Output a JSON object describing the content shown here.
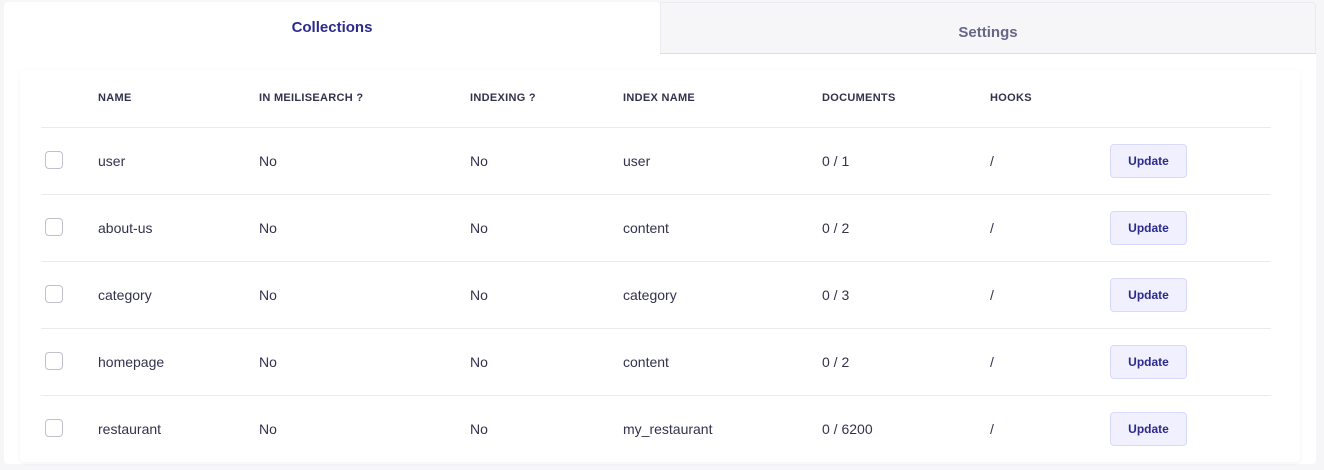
{
  "tabs": [
    {
      "label": "Collections",
      "active": true
    },
    {
      "label": "Settings",
      "active": false
    }
  ],
  "table": {
    "headers": {
      "name": "NAME",
      "in_meilisearch": "IN MEILISEARCH ?",
      "indexing": "INDEXING ?",
      "index_name": "INDEX NAME",
      "documents": "DOCUMENTS",
      "hooks": "HOOKS"
    },
    "rows": [
      {
        "name": "user",
        "in_meilisearch": "No",
        "indexing": "No",
        "index_name": "user",
        "documents": "0 / 1",
        "hooks": "/",
        "action": "Update"
      },
      {
        "name": "about-us",
        "in_meilisearch": "No",
        "indexing": "No",
        "index_name": "content",
        "documents": "0 / 2",
        "hooks": "/",
        "action": "Update"
      },
      {
        "name": "category",
        "in_meilisearch": "No",
        "indexing": "No",
        "index_name": "category",
        "documents": "0 / 3",
        "hooks": "/",
        "action": "Update"
      },
      {
        "name": "homepage",
        "in_meilisearch": "No",
        "indexing": "No",
        "index_name": "content",
        "documents": "0 / 2",
        "hooks": "/",
        "action": "Update"
      },
      {
        "name": "restaurant",
        "in_meilisearch": "No",
        "indexing": "No",
        "index_name": "my_restaurant",
        "documents": "0 / 6200",
        "hooks": "/",
        "action": "Update"
      }
    ]
  },
  "colors": {
    "accent": "#2d2a8e",
    "button_bg": "#f0f0ff",
    "border": "#eaeaef"
  }
}
